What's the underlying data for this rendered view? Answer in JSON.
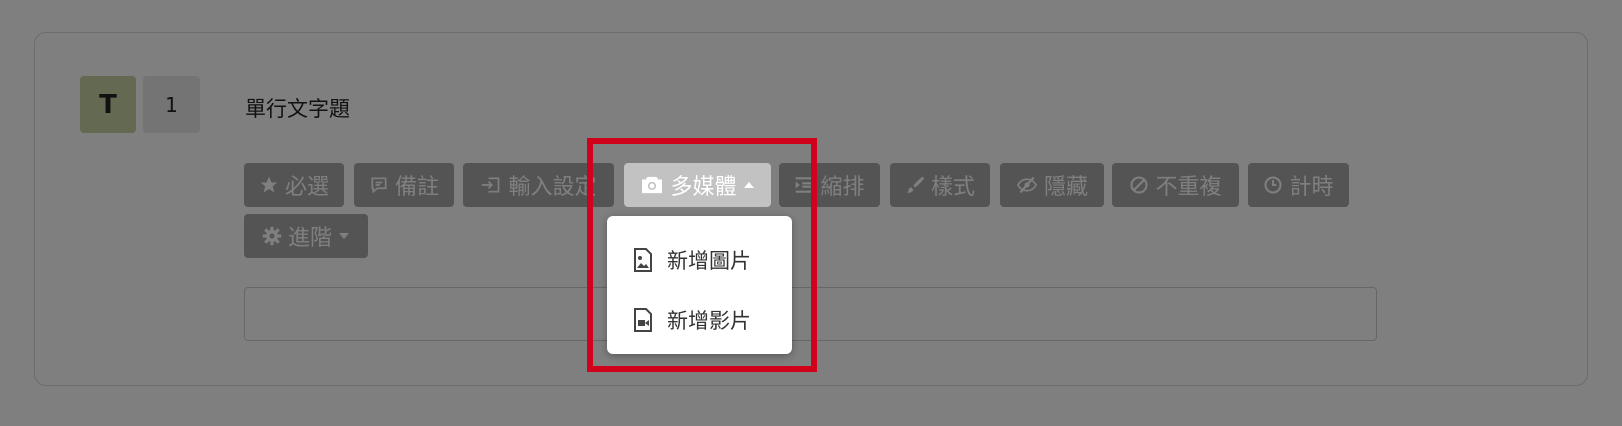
{
  "question": {
    "type_letter": "T",
    "number": "1",
    "title": "單行文字題"
  },
  "toolbar": {
    "required": "必選",
    "note": "備註",
    "input_settings": "輸入設定",
    "multimedia": "多媒體",
    "indent": "縮排",
    "style": "樣式",
    "hide": "隱藏",
    "no_repeat": "不重複",
    "timer": "計時",
    "advanced": "進階"
  },
  "dropdown": {
    "items": [
      {
        "label": "新增圖片",
        "icon": "file-image-icon"
      },
      {
        "label": "新增影片",
        "icon": "file-video-icon"
      }
    ]
  },
  "colors": {
    "highlight": "#d0021b",
    "type_badge": "#c9d5a3"
  }
}
